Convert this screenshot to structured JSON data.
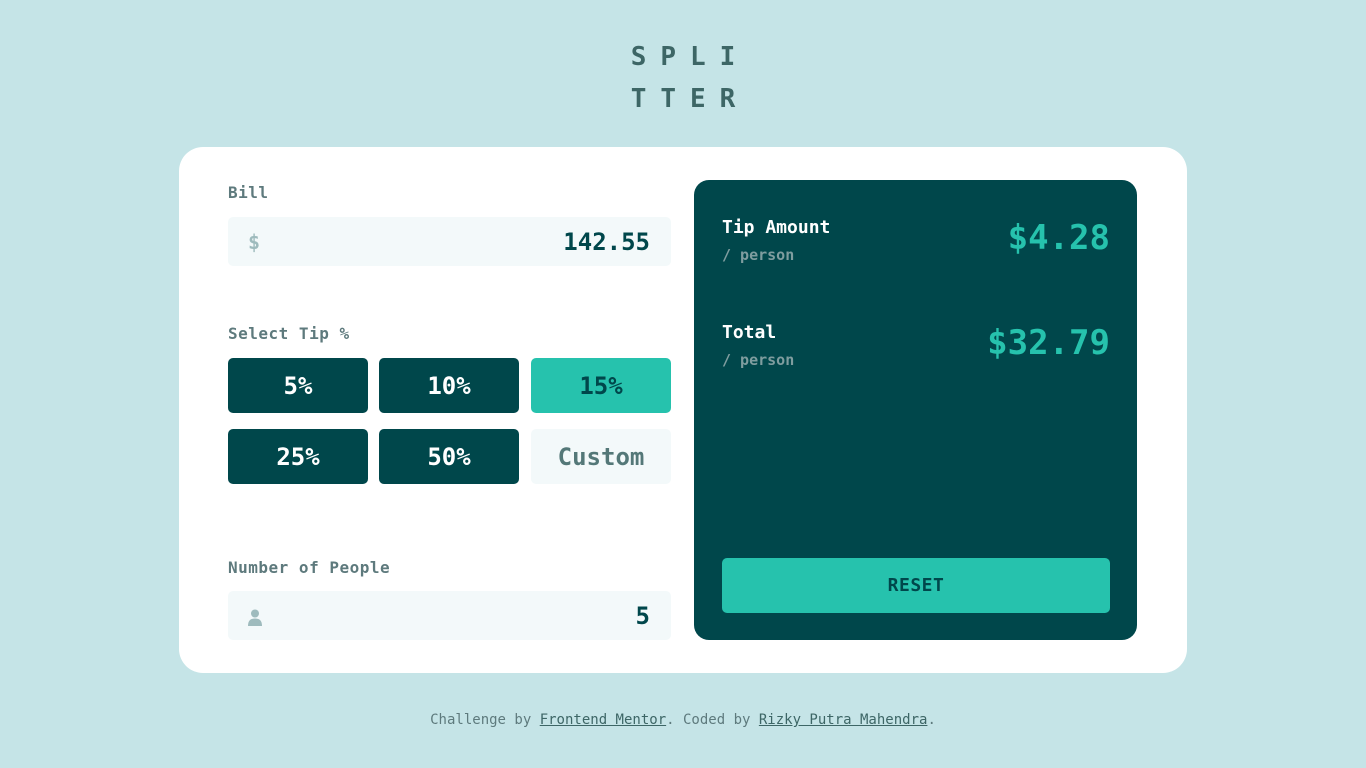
{
  "logo": {
    "line1": "SPLI",
    "line2": "TTER"
  },
  "bill": {
    "label": "Bill",
    "currency_icon": "$",
    "value": "142.55"
  },
  "tip": {
    "label": "Select Tip %",
    "options": [
      "5%",
      "10%",
      "15%",
      "25%",
      "50%"
    ],
    "selected": "15%",
    "custom_placeholder": "Custom"
  },
  "people": {
    "label": "Number of People",
    "icon": "person-icon",
    "value": "5"
  },
  "results": {
    "tip_title": "Tip Amount",
    "tip_sub": "/ person",
    "tip_value": "$4.28",
    "total_title": "Total",
    "total_sub": "/ person",
    "total_value": "$32.79",
    "reset_label": "RESET"
  },
  "footer": {
    "prefix": "Challenge by ",
    "link1": "Frontend Mentor",
    "middle": ". Coded by ",
    "link2": "Rizky Putra Mahendra",
    "suffix": "."
  },
  "colors": {
    "background": "#c5e4e7",
    "dark_cyan": "#00474b",
    "strong_cyan": "#26c2ad",
    "input_bg": "#f3f9fa"
  }
}
